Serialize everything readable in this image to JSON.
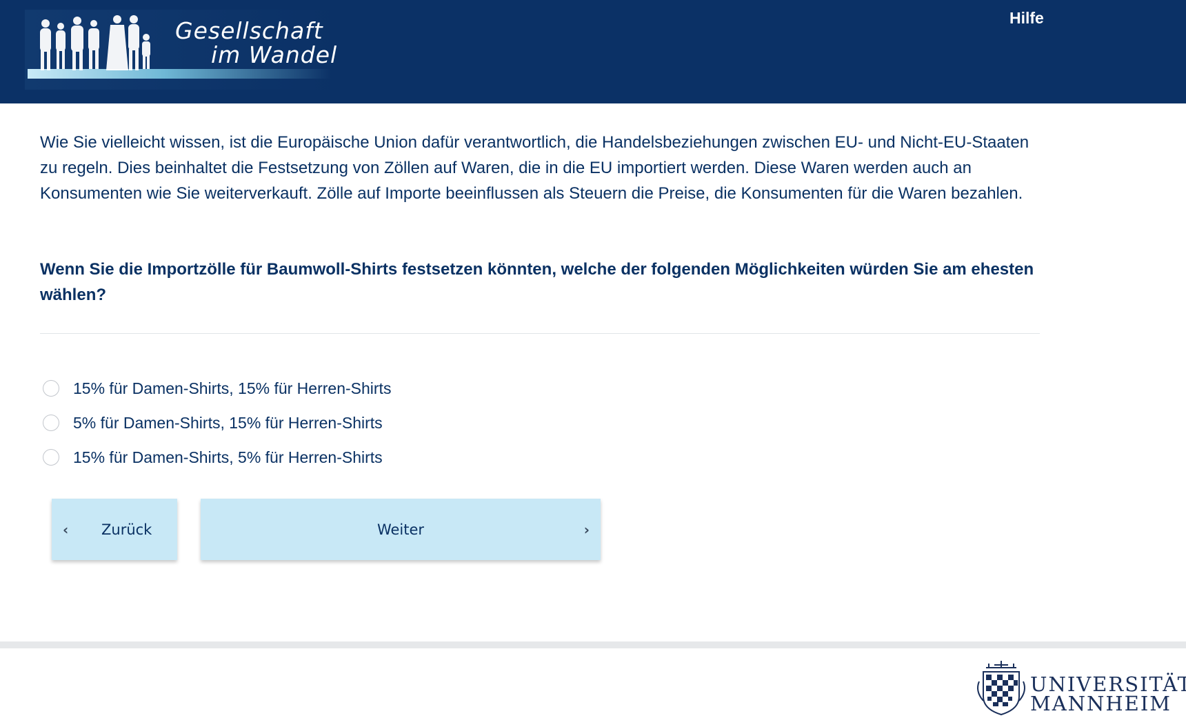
{
  "header": {
    "logo_line1": "Gesellschaft",
    "logo_line2": "im Wandel",
    "help_label": "Hilfe",
    "background_color": "#0b3166"
  },
  "main": {
    "intro_text": "Wie Sie vielleicht wissen, ist die Europäische Union dafür verantwortlich, die Handelsbeziehungen zwischen EU- und Nicht-EU-Staaten zu regeln. Dies beinhaltet die Festsetzung von Zöllen auf Waren, die in die EU importiert werden. Diese Waren werden auch an Konsumenten wie Sie weiterverkauft. Zölle auf Importe beeinflussen als Steuern die Preise, die Konsumenten für die Waren bezahlen.",
    "question_text": "Wenn Sie die Importzölle für Baumwoll-Shirts festsetzen könnten, welche der folgenden Möglichkeiten würden Sie am ehesten wählen?",
    "options": [
      {
        "label": "15% für Damen-Shirts, 15% für Herren-Shirts",
        "selected": false
      },
      {
        "label": "5% für Damen-Shirts, 15% für Herren-Shirts",
        "selected": false
      },
      {
        "label": "15% für Damen-Shirts, 5% für Herren-Shirts",
        "selected": false
      }
    ]
  },
  "navigation": {
    "back_label": "Zurück",
    "next_label": "Weiter",
    "back_icon": "chevron-left-icon",
    "next_icon": "chevron-right-icon",
    "button_color": "#c8e8f6"
  },
  "footer": {
    "university_line1": "UNIVERSITÄT",
    "university_line2": "MANNHEIM"
  }
}
